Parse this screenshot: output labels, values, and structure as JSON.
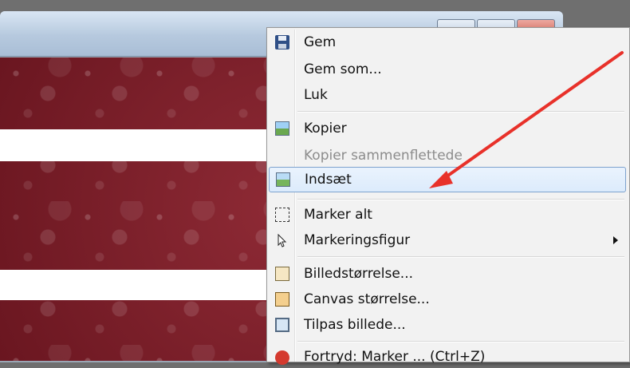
{
  "menu": {
    "items": [
      {
        "label": "Gem",
        "icon": "save-icon"
      },
      {
        "label": "Gem som...",
        "icon": null
      },
      {
        "label": "Luk",
        "icon": null
      },
      {
        "label": "Kopier",
        "icon": "copy-picture-icon"
      },
      {
        "label": "Kopier sammenflettede",
        "icon": null,
        "disabled": true
      },
      {
        "label": "Indsæt",
        "icon": "paste-picture-icon",
        "highlighted": true
      },
      {
        "label": "Marker alt",
        "icon": "select-all-icon"
      },
      {
        "label": "Markeringsfigur",
        "icon": "pointer-icon",
        "submenu": true
      },
      {
        "label": "Billedstørrelse...",
        "icon": "image-size-icon"
      },
      {
        "label": "Canvas størrelse...",
        "icon": "canvas-size-icon"
      },
      {
        "label": "Tilpas billede...",
        "icon": "fit-image-icon"
      },
      {
        "label": "Fortryd: Marker ... (Ctrl+Z)",
        "icon": "undo-icon"
      }
    ]
  },
  "colors": {
    "annotation_arrow": "#e8312a",
    "highlight_border": "#7da2ce",
    "canvas_background": "#7c1d28"
  }
}
